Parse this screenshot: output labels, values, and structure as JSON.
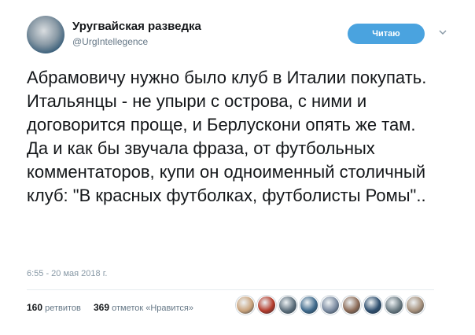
{
  "author": {
    "name": "Уругвайская разведка",
    "handle": "@UrgIntellegence"
  },
  "follow_button": {
    "label": "Читаю"
  },
  "tweet": {
    "paragraphs": [
      "Абрамовичу нужно было клуб в Италии покупать. Итальянцы - не упыри с острова, с ними и договорится проще, и Берлускони опять же там.",
      "Да и как бы звучала фраза, от футбольных комментаторов, купи он одноименный столичный клуб: \"В красных футболках, футболисты Ромы\".."
    ],
    "timestamp": "6:55 - 20 мая 2018 г."
  },
  "stats": {
    "retweets_count": "160",
    "retweets_label": "ретвитов",
    "likes_count": "369",
    "likes_label": "отметок «Нравится»"
  },
  "likers": [
    {
      "color": "#c9a27a"
    },
    {
      "color": "#b33a2a"
    },
    {
      "color": "#5d6f7c"
    },
    {
      "color": "#3f6a8c"
    },
    {
      "color": "#7a8aa0"
    },
    {
      "color": "#8c6b57"
    },
    {
      "color": "#2f4f6f"
    },
    {
      "color": "#6b7b83"
    },
    {
      "color": "#a58f7a"
    }
  ],
  "colors": {
    "accent": "#4aa3df",
    "muted": "#657786"
  }
}
